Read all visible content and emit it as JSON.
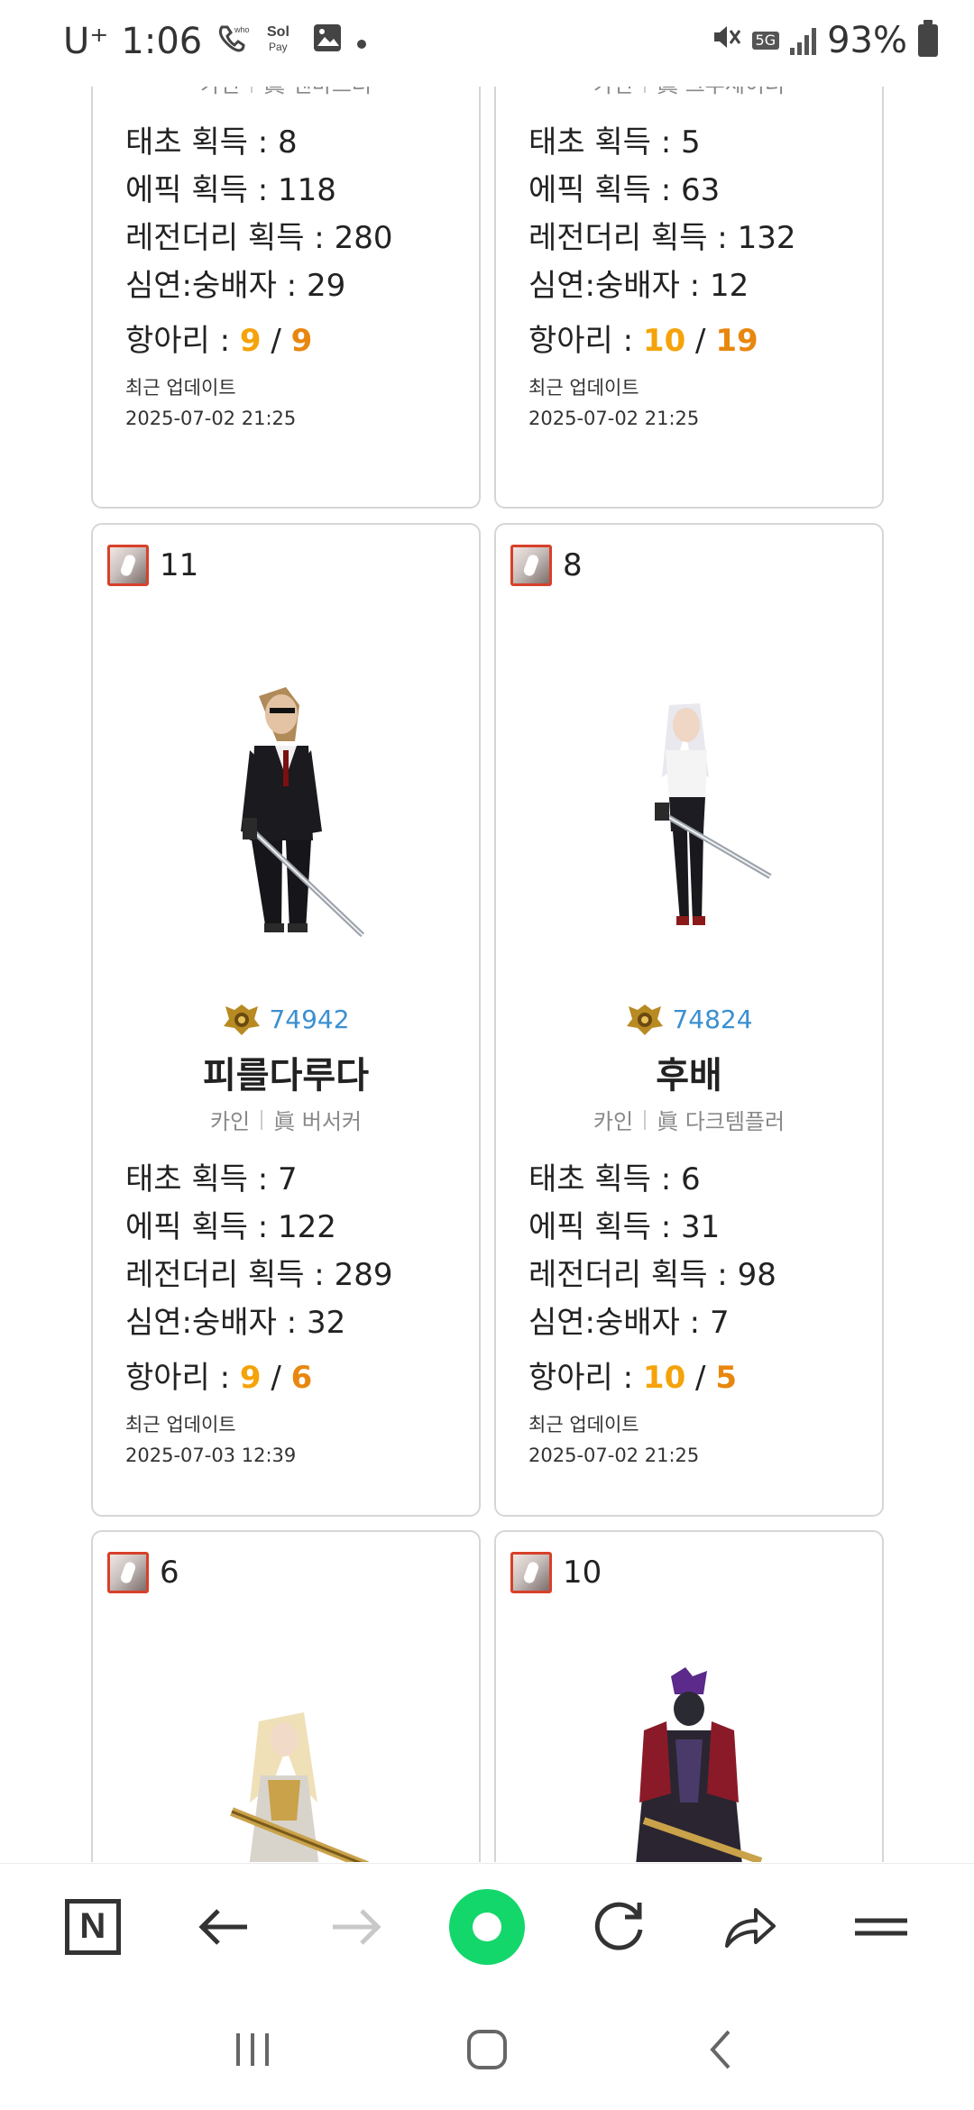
{
  "status_bar": {
    "carrier": "U⁺",
    "time": "1:06",
    "app_icons": [
      "who-who-icon",
      "sol-pay-icon",
      "gallery-icon",
      "dot-icon"
    ],
    "battery": "93%",
    "network": "5G"
  },
  "cards": [
    {
      "guild": "카인",
      "job": "眞 넨마스터",
      "stats": [
        {
          "label": "태초 획득 :",
          "value": "8"
        },
        {
          "label": "에픽 획득 :",
          "value": "118"
        },
        {
          "label": "레전더리 획득 :",
          "value": "280"
        },
        {
          "label": "심연:숭배자 :",
          "value": "29"
        }
      ],
      "hang_label": "항아리 :",
      "hang_a": "9",
      "hang_b": "9",
      "update_label": "최근 업데이트",
      "update_time": "2025-07-02 21:25"
    },
    {
      "guild": "카인",
      "job": "眞 크루세이더",
      "stats": [
        {
          "label": "태초 획득 :",
          "value": "5"
        },
        {
          "label": "에픽 획득 :",
          "value": "63"
        },
        {
          "label": "레전더리 획득 :",
          "value": "132"
        },
        {
          "label": "심연:숭배자 :",
          "value": "12"
        }
      ],
      "hang_label": "항아리 :",
      "hang_a": "10",
      "hang_b": "19",
      "update_label": "최근 업데이트",
      "update_time": "2025-07-02 21:25"
    },
    {
      "rank": "11",
      "fame": "74942",
      "name": "피를다루다",
      "guild": "카인",
      "job": "眞 버서커",
      "stats": [
        {
          "label": "태초 획득 :",
          "value": "7"
        },
        {
          "label": "에픽 획득 :",
          "value": "122"
        },
        {
          "label": "레전더리 획득 :",
          "value": "289"
        },
        {
          "label": "심연:숭배자 :",
          "value": "32"
        }
      ],
      "hang_label": "항아리 :",
      "hang_a": "9",
      "hang_b": "6",
      "update_label": "최근 업데이트",
      "update_time": "2025-07-03 12:39"
    },
    {
      "rank": "8",
      "fame": "74824",
      "name": "후배",
      "guild": "카인",
      "job": "眞 다크템플러",
      "stats": [
        {
          "label": "태초 획득 :",
          "value": "6"
        },
        {
          "label": "에픽 획득 :",
          "value": "31"
        },
        {
          "label": "레전더리 획득 :",
          "value": "98"
        },
        {
          "label": "심연:숭배자 :",
          "value": "7"
        }
      ],
      "hang_label": "항아리 :",
      "hang_a": "10",
      "hang_b": "5",
      "update_label": "최근 업데이트",
      "update_time": "2025-07-02 21:25"
    },
    {
      "rank": "6"
    },
    {
      "rank": "10"
    }
  ],
  "toolbar": {
    "items": [
      "naver-home-icon",
      "back-arrow-icon",
      "forward-arrow-icon",
      "green-dot-icon",
      "refresh-icon",
      "share-icon",
      "menu-icon"
    ]
  },
  "navbar": {
    "items": [
      "recent-apps-icon",
      "home-icon",
      "back-icon"
    ]
  }
}
